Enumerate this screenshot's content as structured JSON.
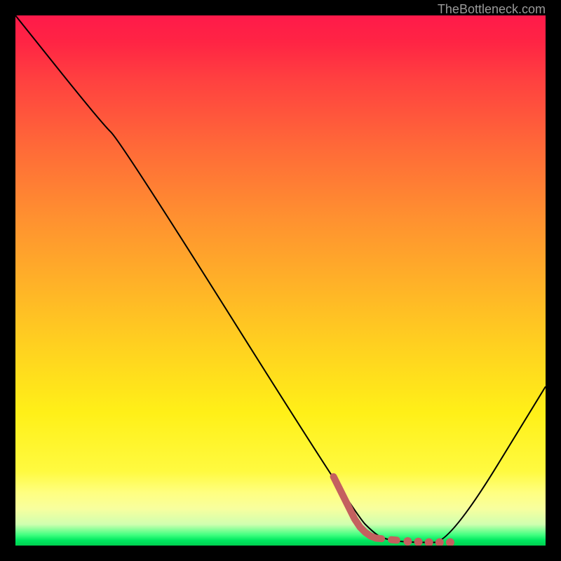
{
  "attribution": "TheBottleneck.com",
  "colors": {
    "curve_black": "#000000",
    "curve_accent": "#c4605f"
  },
  "chart_data": {
    "type": "line",
    "title": "",
    "xlabel": "",
    "ylabel": "",
    "xlim": [
      0,
      100
    ],
    "ylim": [
      0,
      100
    ],
    "series": [
      {
        "name": "bottleneck-curve",
        "color": "#000000",
        "stroke_width": 2,
        "x": [
          0,
          16,
          20,
          64,
          68,
          70,
          72,
          76,
          82,
          100
        ],
        "y": [
          100,
          80,
          76,
          6,
          2,
          1.2,
          0.8,
          0.6,
          0.6,
          30
        ]
      },
      {
        "name": "highlight-segment",
        "color": "#c4605f",
        "style": "thick-dotted",
        "x": [
          60,
          63,
          64,
          65,
          66,
          67,
          68,
          70,
          72,
          74,
          76,
          78,
          80,
          82
        ],
        "y": [
          13,
          7,
          5,
          3.5,
          2.5,
          1.8,
          1.4,
          1.2,
          1.0,
          0.8,
          0.7,
          0.6,
          0.6,
          0.6
        ]
      }
    ]
  }
}
